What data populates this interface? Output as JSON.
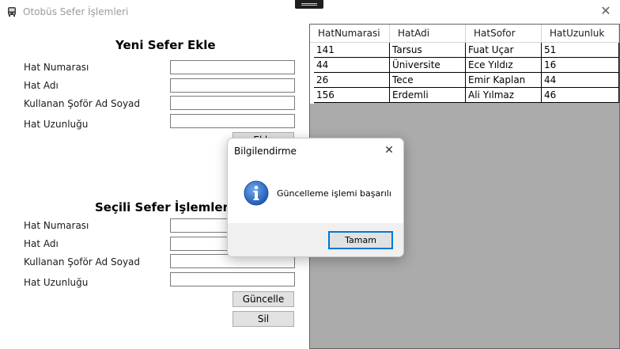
{
  "window": {
    "title": "Otobüs Sefer İşlemleri",
    "close_glyph": "✕"
  },
  "new_trip": {
    "heading": "Yeni Sefer Ekle",
    "fields": [
      {
        "label": "Hat Numarası",
        "value": ""
      },
      {
        "label": "Hat Adı",
        "value": ""
      },
      {
        "label": "Kullanan Şoför Ad Soyad",
        "value": ""
      },
      {
        "label": "Hat Uzunluğu",
        "value": ""
      }
    ],
    "add_button": "Ekle"
  },
  "selected_trip": {
    "heading": "Seçili Sefer İşlemleri",
    "fields": [
      {
        "label": "Hat Numarası",
        "value": ""
      },
      {
        "label": "Hat Adı",
        "value": ""
      },
      {
        "label": "Kullanan Şoför Ad Soyad",
        "value": ""
      },
      {
        "label": "Hat Uzunluğu",
        "value": ""
      }
    ],
    "update_button": "Güncelle",
    "delete_button": "Sil"
  },
  "grid": {
    "columns": [
      "HatNumarasi",
      "HatAdi",
      "HatSofor",
      "HatUzunluk"
    ],
    "rows": [
      [
        "141",
        "Tarsus",
        "Fuat Uçar",
        "51"
      ],
      [
        "44",
        "Üniversite",
        "Ece Yıldız",
        "16"
      ],
      [
        "26",
        "Tece",
        "Emir Kaplan",
        "44"
      ],
      [
        "156",
        "Erdemli",
        "Ali Yılmaz",
        "46"
      ]
    ]
  },
  "dialog": {
    "title": "Bilgilendirme",
    "message": "Güncelleme işlemi başarılı",
    "ok_button": "Tamam",
    "close_glyph": "✕"
  },
  "colors": {
    "accent": "#0078d7",
    "grid_bg": "#ababab",
    "button_bg": "#e1e1e1",
    "info_icon": "#2f6dc2"
  }
}
